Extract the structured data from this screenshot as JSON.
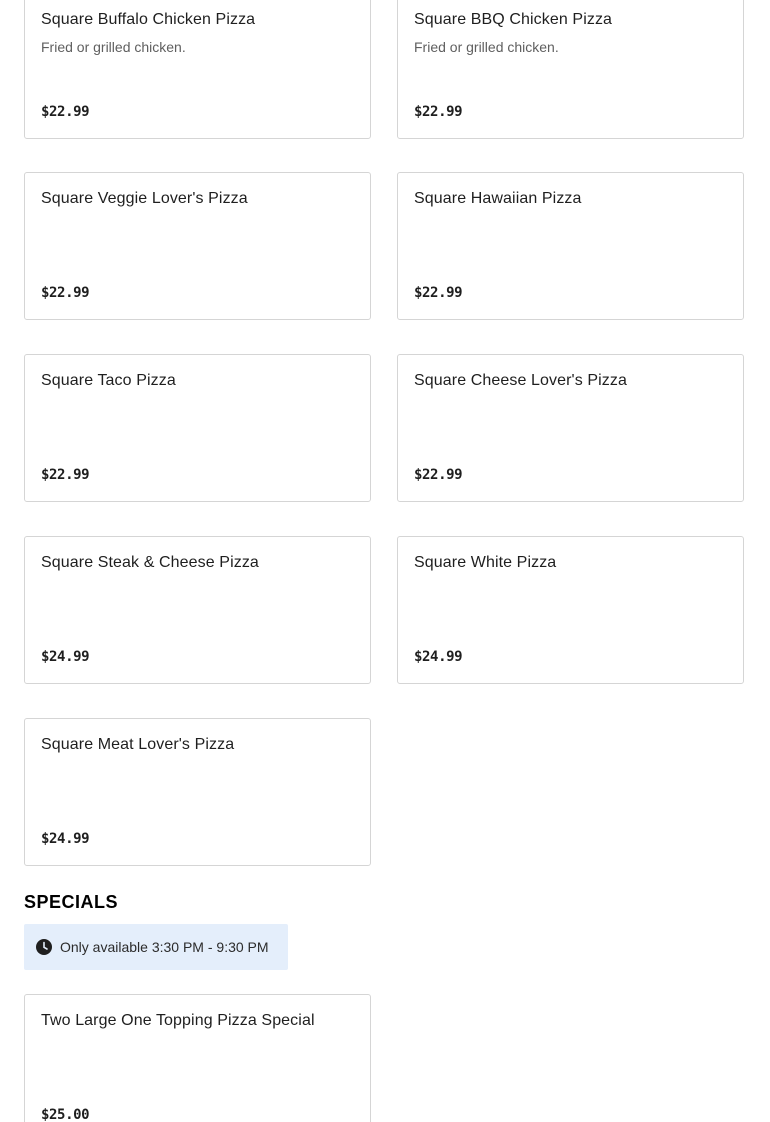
{
  "items": [
    {
      "name": "Square Buffalo Chicken Pizza",
      "description": "Fried or grilled chicken.",
      "price": "$22.99"
    },
    {
      "name": "Square BBQ Chicken Pizza",
      "description": "Fried or grilled chicken.",
      "price": "$22.99"
    },
    {
      "name": "Square Veggie Lover's Pizza",
      "description": "",
      "price": "$22.99"
    },
    {
      "name": "Square Hawaiian Pizza",
      "description": "",
      "price": "$22.99"
    },
    {
      "name": "Square Taco Pizza",
      "description": "",
      "price": "$22.99"
    },
    {
      "name": "Square Cheese Lover's Pizza",
      "description": "",
      "price": "$22.99"
    },
    {
      "name": "Square Steak & Cheese Pizza",
      "description": "",
      "price": "$24.99"
    },
    {
      "name": "Square White Pizza",
      "description": "",
      "price": "$24.99"
    },
    {
      "name": "Square Meat Lover's Pizza",
      "description": "",
      "price": "$24.99"
    }
  ],
  "specials": {
    "title": "SPECIALS",
    "availability_icon": "clock-icon",
    "availability_text": "Only available 3:30 PM - 9:30 PM",
    "items": [
      {
        "name": "Two Large One Topping Pizza Special",
        "description": "",
        "price": "$25.00"
      }
    ]
  },
  "colors": {
    "availability_bg": "#e4eefb",
    "card_border": "#d5d5d5"
  }
}
